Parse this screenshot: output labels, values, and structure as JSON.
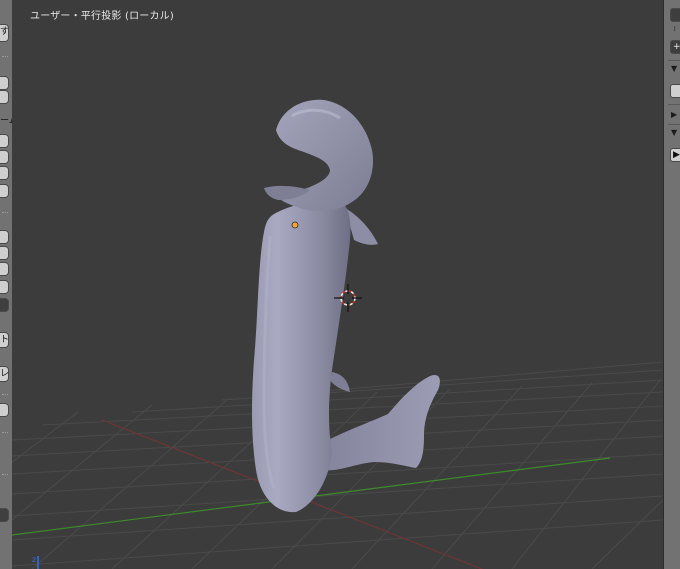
{
  "viewport": {
    "label": "ユーザー・平行投影 (ローカル)"
  },
  "left_shelf": {
    "button_1": "す",
    "section_label": "ーム",
    "button_t": "ト",
    "button_re": "レ"
  },
  "right_shelf": {
    "plus_glyph": "+",
    "play_glyph": "▶"
  },
  "colors": {
    "viewport_bg": "#3c3c3c",
    "grid": "#4b4b4b",
    "x_axis": "#7a3a3a",
    "y_axis": "#3f8a2a",
    "mesh": "#8d8ea6",
    "origin": "#f2a33a"
  },
  "icons": [
    "3d-cursor-icon",
    "object-origin-icon",
    "axis-gizmo-icon"
  ]
}
